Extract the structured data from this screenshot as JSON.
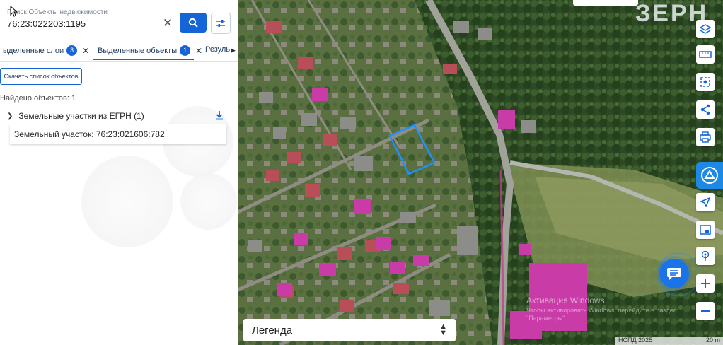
{
  "search": {
    "label": "Поиск Объекты недвижимости",
    "value": "76:23:022203:1195"
  },
  "tabs": [
    {
      "label": "ыделенные слои",
      "count": "3"
    },
    {
      "label": "Выделенные объекты",
      "count": "1"
    },
    {
      "label": "Резуль"
    }
  ],
  "download_label": "Скачать список объектов",
  "found_text": "Найдено объектов: 1",
  "group": {
    "label": "Земельные участки из ЕГРН (1)"
  },
  "result_item": "Земельный участок: 76:23:021606:782",
  "map": {
    "watermark": "ЗЕРН",
    "legend_label": "Легенда",
    "windows_activation_title": "Активация Windows",
    "windows_activation_text": "Чтобы активировать Windows, перейдите в раздел \"Параметры\".",
    "attribution": "НСПД 2025",
    "scale": "20 m",
    "highlight_color": "#1e90ff",
    "controls": [
      "layers-icon",
      "ruler-icon",
      "select-area-icon",
      "share-icon",
      "print-icon",
      "service-logo-icon",
      "locate-icon",
      "minimap-icon",
      "touch-icon",
      "zoom-in-icon",
      "zoom-out-icon"
    ]
  },
  "colors": {
    "accent": "#1565d8"
  }
}
